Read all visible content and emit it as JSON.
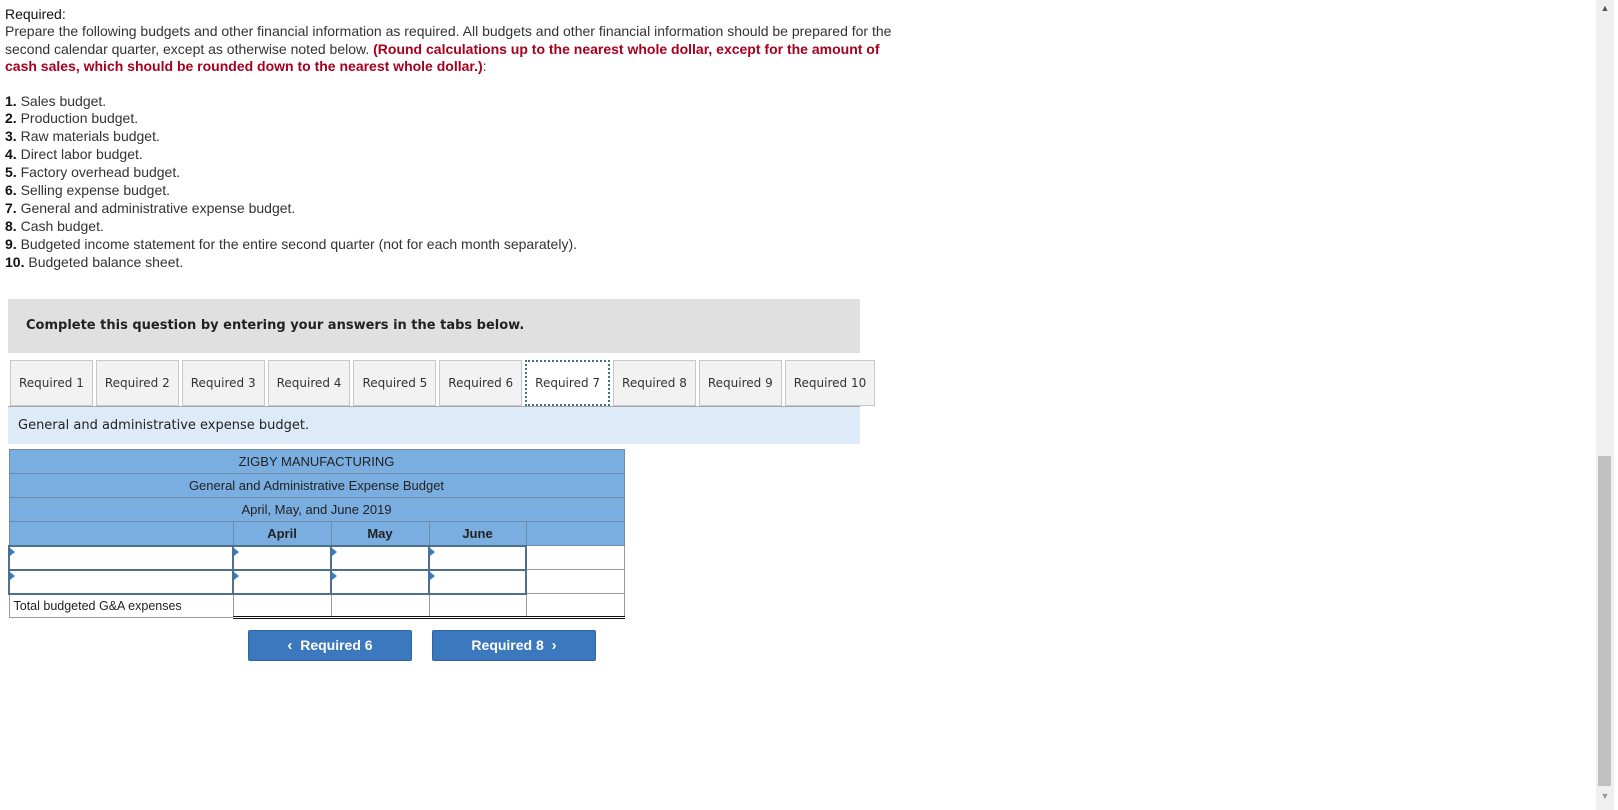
{
  "required_heading": "Required:",
  "intro": {
    "text": "Prepare the following budgets and other financial information as required. All budgets and other financial information should be prepared for the second calendar quarter, except as otherwise noted below. ",
    "red_note": "(Round calculations up to the nearest whole dollar, except for the amount of cash sales, which should be rounded down to the nearest whole dollar.)",
    "suffix": ":"
  },
  "tasks": [
    {
      "num": "1.",
      "text": " Sales budget."
    },
    {
      "num": "2.",
      "text": " Production budget."
    },
    {
      "num": "3.",
      "text": " Raw materials budget."
    },
    {
      "num": "4.",
      "text": " Direct labor budget."
    },
    {
      "num": "5.",
      "text": " Factory overhead budget."
    },
    {
      "num": "6.",
      "text": " Selling expense budget."
    },
    {
      "num": "7.",
      "text": " General and administrative expense budget."
    },
    {
      "num": "8.",
      "text": " Cash budget."
    },
    {
      "num": "9.",
      "text": " Budgeted income statement for the entire second quarter (not for each month separately)."
    },
    {
      "num": "10.",
      "text": " Budgeted balance sheet."
    }
  ],
  "banner": "Complete this question by entering your answers in the tabs below.",
  "tabs": [
    {
      "label": "Required 1"
    },
    {
      "label": "Required 2"
    },
    {
      "label": "Required 3"
    },
    {
      "label": "Required 4"
    },
    {
      "label": "Required 5"
    },
    {
      "label": "Required 6"
    },
    {
      "label": "Required 7",
      "active": true
    },
    {
      "label": "Required 8"
    },
    {
      "label": "Required 9"
    },
    {
      "label": "Required 10"
    }
  ],
  "subheading": "General and administrative expense budget.",
  "budget": {
    "company": "ZIGBY MANUFACTURING",
    "title": "General and Administrative Expense Budget",
    "period": "April, May, and June 2019",
    "columns": [
      "April",
      "May",
      "June",
      ""
    ],
    "rows": [
      {
        "label": "",
        "values": [
          "",
          "",
          "",
          ""
        ]
      },
      {
        "label": "",
        "values": [
          "",
          "",
          "",
          ""
        ]
      }
    ],
    "total_label": "Total budgeted G&A expenses",
    "total_values": [
      "",
      "",
      "",
      ""
    ]
  },
  "nav": {
    "prev_label": "Required 6",
    "next_label": "Required 8",
    "prev_icon": "‹",
    "next_icon": "›"
  },
  "colors": {
    "accent": "#3b78be",
    "header_blue": "#7aaee0",
    "note_red": "#a5001e",
    "subhead_bg": "#dcebf7"
  }
}
